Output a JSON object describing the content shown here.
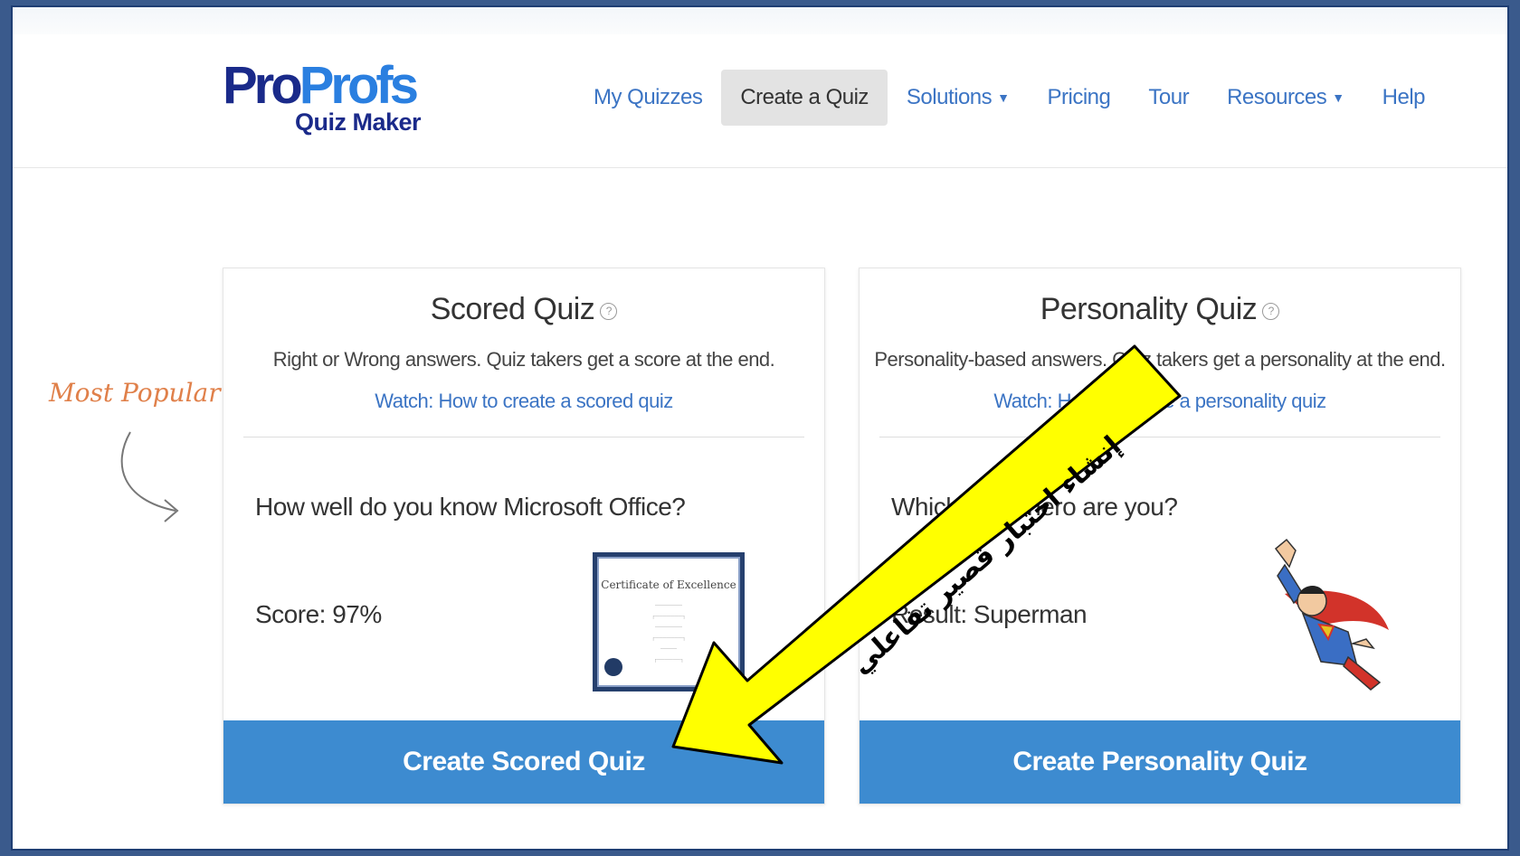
{
  "logo": {
    "main_a": "Pro",
    "main_b": "Profs",
    "sub": "Quiz Maker"
  },
  "nav": {
    "items": [
      {
        "label": "My Quizzes",
        "caret": false,
        "active": false
      },
      {
        "label": "Create a Quiz",
        "caret": false,
        "active": true
      },
      {
        "label": "Solutions",
        "caret": true,
        "active": false
      },
      {
        "label": "Pricing",
        "caret": false,
        "active": false
      },
      {
        "label": "Tour",
        "caret": false,
        "active": false
      },
      {
        "label": "Resources",
        "caret": true,
        "active": false
      },
      {
        "label": "Help",
        "caret": false,
        "active": false
      }
    ]
  },
  "sidebar": {
    "most_popular": "Most Popular"
  },
  "cards": {
    "scored": {
      "title": "Scored Quiz",
      "desc": "Right or Wrong answers. Quiz takers get a score at the end.",
      "link": "Watch: How to create a scored quiz",
      "sample_question": "How well do you know Microsoft Office?",
      "sample_result": "Score: 97%",
      "certificate_title": "Certificate of Excellence",
      "button": "Create Scored Quiz"
    },
    "personality": {
      "title": "Personality Quiz",
      "desc": "Personality-based answers. Quiz takers get a personality at the end.",
      "link": "Watch: How to create a personality quiz",
      "sample_question": "Which superhero are you?",
      "sample_result": "Result: Superman",
      "button": "Create Personality Quiz"
    }
  },
  "annotation": {
    "text": "إنشاء اختبار قصير تفاعلي",
    "color": "#ffff00"
  },
  "colors": {
    "accent": "#3d8bd0",
    "link": "#3b74c4",
    "logo_dark": "#1a2a8a",
    "logo_light": "#2a7fe0"
  }
}
